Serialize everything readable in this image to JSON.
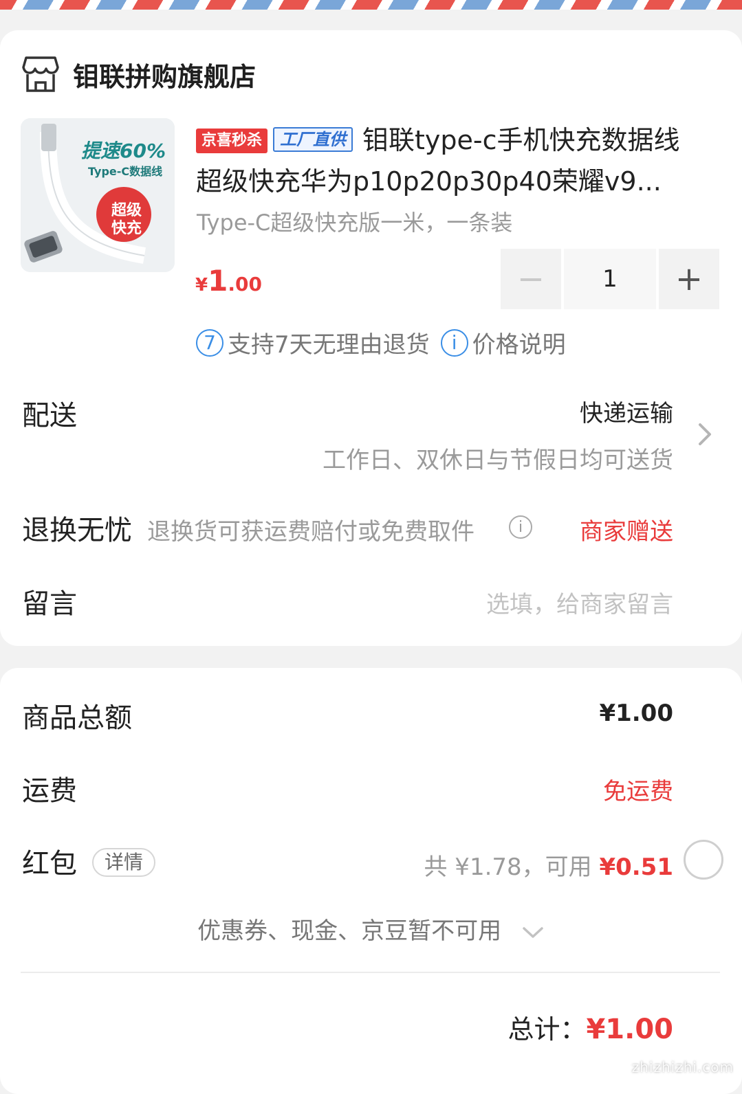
{
  "store": {
    "name": "钼联拼购旗舰店",
    "icon": "store-icon"
  },
  "product": {
    "thumb_text": {
      "line1": "提速60%",
      "line2": "Type-C数据线",
      "stamp1": "超级",
      "stamp2": "快充"
    },
    "badge_seckill": "京喜秒杀",
    "badge_factory": "工厂直供",
    "title": "钼联type-c手机快充数据线超级快充华为p10p20p30p40荣耀v9...",
    "spec": "Type-C超级快充版一米，一条装",
    "price": {
      "currency": "¥",
      "int": "1",
      "dec": ".00"
    },
    "quantity": "1",
    "minus": "−",
    "plus": "+",
    "service_badge": "7",
    "service_return": "支持7天无理由退货",
    "service_info_icon": "i",
    "service_price": "价格说明"
  },
  "delivery": {
    "label": "配送",
    "method": "快递运输",
    "desc": "工作日、双休日与节假日均可送货"
  },
  "exchange": {
    "label": "退换无忧",
    "desc": "退换货可获运费赔付或免费取件",
    "info": "i",
    "value": "商家赠送"
  },
  "message": {
    "label": "留言",
    "placeholder": "选填，给商家留言"
  },
  "summary": {
    "goods_label": "商品总额",
    "goods_value": "¥1.00",
    "shipping_label": "运费",
    "shipping_value": "免运费",
    "redpacket_label": "红包",
    "redpacket_detail": "详情",
    "redpacket_total": "共 ¥1.78，可用 ",
    "redpacket_avail": "¥0.51",
    "coupon_note": "优惠券、现金、京豆暂不可用",
    "total_label": "总计：",
    "total_value": "¥1.00"
  },
  "watermark": "zhizhizhi.com",
  "colors": {
    "accent_red": "#e93b3b",
    "info_blue": "#3a8ee6",
    "muted": "#9a9a9a"
  }
}
